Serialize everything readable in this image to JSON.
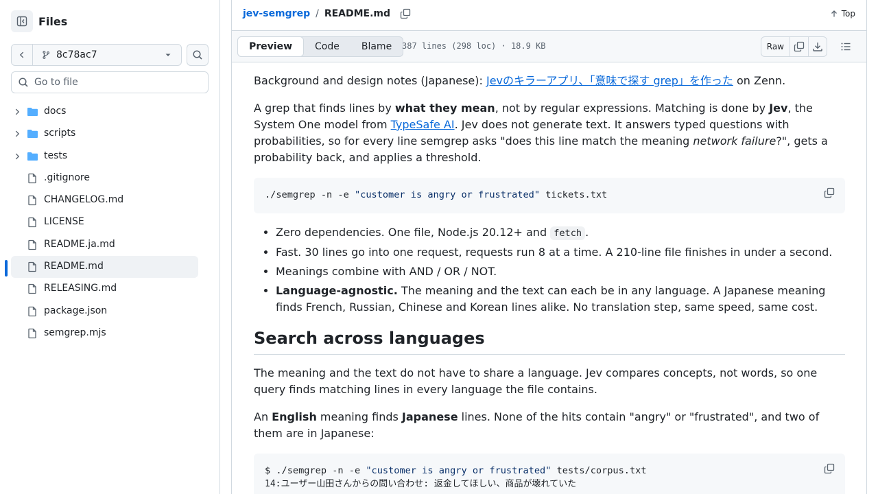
{
  "sidebar": {
    "title": "Files",
    "branch": "8c78ac7",
    "goto_placeholder": "Go to file",
    "items": [
      {
        "label": "docs",
        "type": "folder"
      },
      {
        "label": "scripts",
        "type": "folder"
      },
      {
        "label": "tests",
        "type": "folder"
      },
      {
        "label": ".gitignore",
        "type": "file"
      },
      {
        "label": "CHANGELOG.md",
        "type": "file"
      },
      {
        "label": "LICENSE",
        "type": "file"
      },
      {
        "label": "README.ja.md",
        "type": "file"
      },
      {
        "label": "README.md",
        "type": "file",
        "active": true
      },
      {
        "label": "RELEASING.md",
        "type": "file"
      },
      {
        "label": "package.json",
        "type": "file"
      },
      {
        "label": "semgrep.mjs",
        "type": "file"
      }
    ]
  },
  "header": {
    "repo": "jev-semgrep",
    "separator": "/",
    "file": "README.md",
    "top_label": "Top"
  },
  "toolbar": {
    "tabs": [
      "Preview",
      "Code",
      "Blame"
    ],
    "file_info": "387 lines (298 loc) · 18.9 KB",
    "raw_label": "Raw"
  },
  "readme": {
    "notes_prefix": "Background and design notes (Japanese): ",
    "notes_link": "Jevのキラーアプリ、「意味で探す grep」を作った",
    "notes_suffix": " on Zenn.",
    "intro_1": "A grep that finds lines by ",
    "intro_bold_1": "what they mean",
    "intro_2": ", not by regular expressions. Matching is done by ",
    "intro_bold_2": "Jev",
    "intro_3": ", the System One model from ",
    "intro_link": "TypeSafe AI",
    "intro_4": ". Jev does not generate text. It answers typed questions with probabilities, so for every line semgrep asks \"does this line match the meaning ",
    "intro_italic": "network failure",
    "intro_5": "?\", gets a probability back, and applies a threshold.",
    "code1_cmd": "./semgrep -n -e ",
    "code1_str": "\"customer is angry or frustrated\"",
    "code1_tail": " tickets.txt",
    "bullet1_pre": "Zero dependencies. One file, Node.js 20.12+ and ",
    "bullet1_code": "fetch",
    "bullet1_post": ".",
    "bullet2": "Fast. 30 lines go into one request, requests run 8 at a time. A 210-line file finishes in under a second.",
    "bullet3": "Meanings combine with AND / OR / NOT.",
    "bullet4_bold": "Language-agnostic.",
    "bullet4": " The meaning and the text can each be in any language. A Japanese meaning finds French, Russian, Chinese and Korean lines alike. No translation step, same speed, same cost.",
    "h2": "Search across languages",
    "p2": "The meaning and the text do not have to share a language. Jev compares concepts, not words, so one query finds matching lines in every language the file contains.",
    "p3_1": "An ",
    "p3_b1": "English",
    "p3_2": " meaning finds ",
    "p3_b2": "Japanese",
    "p3_3": " lines. None of the hits contain \"angry\" or \"frustrated\", and two of them are in Japanese:",
    "code2_cmd": "$ ./semgrep -n -e ",
    "code2_str": "\"customer is angry or frustrated\"",
    "code2_tail": " tests/corpus.txt",
    "code2_line": "14:ユーザー山田さんからの問い合わせ: 返金してほしい、商品が壊れていた"
  }
}
